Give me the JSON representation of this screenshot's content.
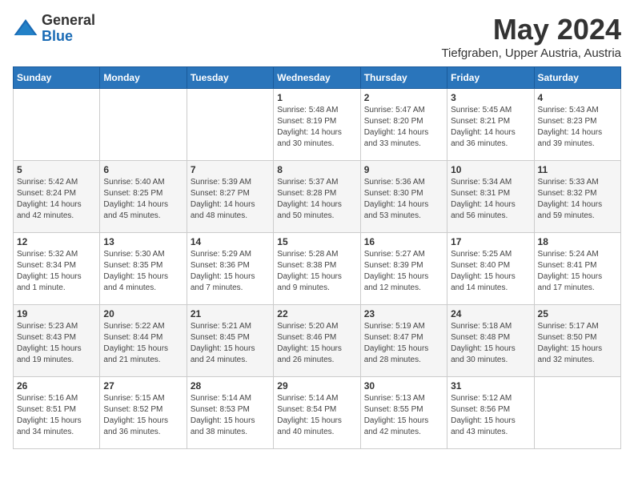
{
  "logo": {
    "general": "General",
    "blue": "Blue"
  },
  "title": {
    "month_year": "May 2024",
    "location": "Tiefgraben, Upper Austria, Austria"
  },
  "weekdays": [
    "Sunday",
    "Monday",
    "Tuesday",
    "Wednesday",
    "Thursday",
    "Friday",
    "Saturday"
  ],
  "weeks": [
    [
      {
        "day": "",
        "info": ""
      },
      {
        "day": "",
        "info": ""
      },
      {
        "day": "",
        "info": ""
      },
      {
        "day": "1",
        "info": "Sunrise: 5:48 AM\nSunset: 8:19 PM\nDaylight: 14 hours\nand 30 minutes."
      },
      {
        "day": "2",
        "info": "Sunrise: 5:47 AM\nSunset: 8:20 PM\nDaylight: 14 hours\nand 33 minutes."
      },
      {
        "day": "3",
        "info": "Sunrise: 5:45 AM\nSunset: 8:21 PM\nDaylight: 14 hours\nand 36 minutes."
      },
      {
        "day": "4",
        "info": "Sunrise: 5:43 AM\nSunset: 8:23 PM\nDaylight: 14 hours\nand 39 minutes."
      }
    ],
    [
      {
        "day": "5",
        "info": "Sunrise: 5:42 AM\nSunset: 8:24 PM\nDaylight: 14 hours\nand 42 minutes."
      },
      {
        "day": "6",
        "info": "Sunrise: 5:40 AM\nSunset: 8:25 PM\nDaylight: 14 hours\nand 45 minutes."
      },
      {
        "day": "7",
        "info": "Sunrise: 5:39 AM\nSunset: 8:27 PM\nDaylight: 14 hours\nand 48 minutes."
      },
      {
        "day": "8",
        "info": "Sunrise: 5:37 AM\nSunset: 8:28 PM\nDaylight: 14 hours\nand 50 minutes."
      },
      {
        "day": "9",
        "info": "Sunrise: 5:36 AM\nSunset: 8:30 PM\nDaylight: 14 hours\nand 53 minutes."
      },
      {
        "day": "10",
        "info": "Sunrise: 5:34 AM\nSunset: 8:31 PM\nDaylight: 14 hours\nand 56 minutes."
      },
      {
        "day": "11",
        "info": "Sunrise: 5:33 AM\nSunset: 8:32 PM\nDaylight: 14 hours\nand 59 minutes."
      }
    ],
    [
      {
        "day": "12",
        "info": "Sunrise: 5:32 AM\nSunset: 8:34 PM\nDaylight: 15 hours\nand 1 minute."
      },
      {
        "day": "13",
        "info": "Sunrise: 5:30 AM\nSunset: 8:35 PM\nDaylight: 15 hours\nand 4 minutes."
      },
      {
        "day": "14",
        "info": "Sunrise: 5:29 AM\nSunset: 8:36 PM\nDaylight: 15 hours\nand 7 minutes."
      },
      {
        "day": "15",
        "info": "Sunrise: 5:28 AM\nSunset: 8:38 PM\nDaylight: 15 hours\nand 9 minutes."
      },
      {
        "day": "16",
        "info": "Sunrise: 5:27 AM\nSunset: 8:39 PM\nDaylight: 15 hours\nand 12 minutes."
      },
      {
        "day": "17",
        "info": "Sunrise: 5:25 AM\nSunset: 8:40 PM\nDaylight: 15 hours\nand 14 minutes."
      },
      {
        "day": "18",
        "info": "Sunrise: 5:24 AM\nSunset: 8:41 PM\nDaylight: 15 hours\nand 17 minutes."
      }
    ],
    [
      {
        "day": "19",
        "info": "Sunrise: 5:23 AM\nSunset: 8:43 PM\nDaylight: 15 hours\nand 19 minutes."
      },
      {
        "day": "20",
        "info": "Sunrise: 5:22 AM\nSunset: 8:44 PM\nDaylight: 15 hours\nand 21 minutes."
      },
      {
        "day": "21",
        "info": "Sunrise: 5:21 AM\nSunset: 8:45 PM\nDaylight: 15 hours\nand 24 minutes."
      },
      {
        "day": "22",
        "info": "Sunrise: 5:20 AM\nSunset: 8:46 PM\nDaylight: 15 hours\nand 26 minutes."
      },
      {
        "day": "23",
        "info": "Sunrise: 5:19 AM\nSunset: 8:47 PM\nDaylight: 15 hours\nand 28 minutes."
      },
      {
        "day": "24",
        "info": "Sunrise: 5:18 AM\nSunset: 8:48 PM\nDaylight: 15 hours\nand 30 minutes."
      },
      {
        "day": "25",
        "info": "Sunrise: 5:17 AM\nSunset: 8:50 PM\nDaylight: 15 hours\nand 32 minutes."
      }
    ],
    [
      {
        "day": "26",
        "info": "Sunrise: 5:16 AM\nSunset: 8:51 PM\nDaylight: 15 hours\nand 34 minutes."
      },
      {
        "day": "27",
        "info": "Sunrise: 5:15 AM\nSunset: 8:52 PM\nDaylight: 15 hours\nand 36 minutes."
      },
      {
        "day": "28",
        "info": "Sunrise: 5:14 AM\nSunset: 8:53 PM\nDaylight: 15 hours\nand 38 minutes."
      },
      {
        "day": "29",
        "info": "Sunrise: 5:14 AM\nSunset: 8:54 PM\nDaylight: 15 hours\nand 40 minutes."
      },
      {
        "day": "30",
        "info": "Sunrise: 5:13 AM\nSunset: 8:55 PM\nDaylight: 15 hours\nand 42 minutes."
      },
      {
        "day": "31",
        "info": "Sunrise: 5:12 AM\nSunset: 8:56 PM\nDaylight: 15 hours\nand 43 minutes."
      },
      {
        "day": "",
        "info": ""
      }
    ]
  ]
}
